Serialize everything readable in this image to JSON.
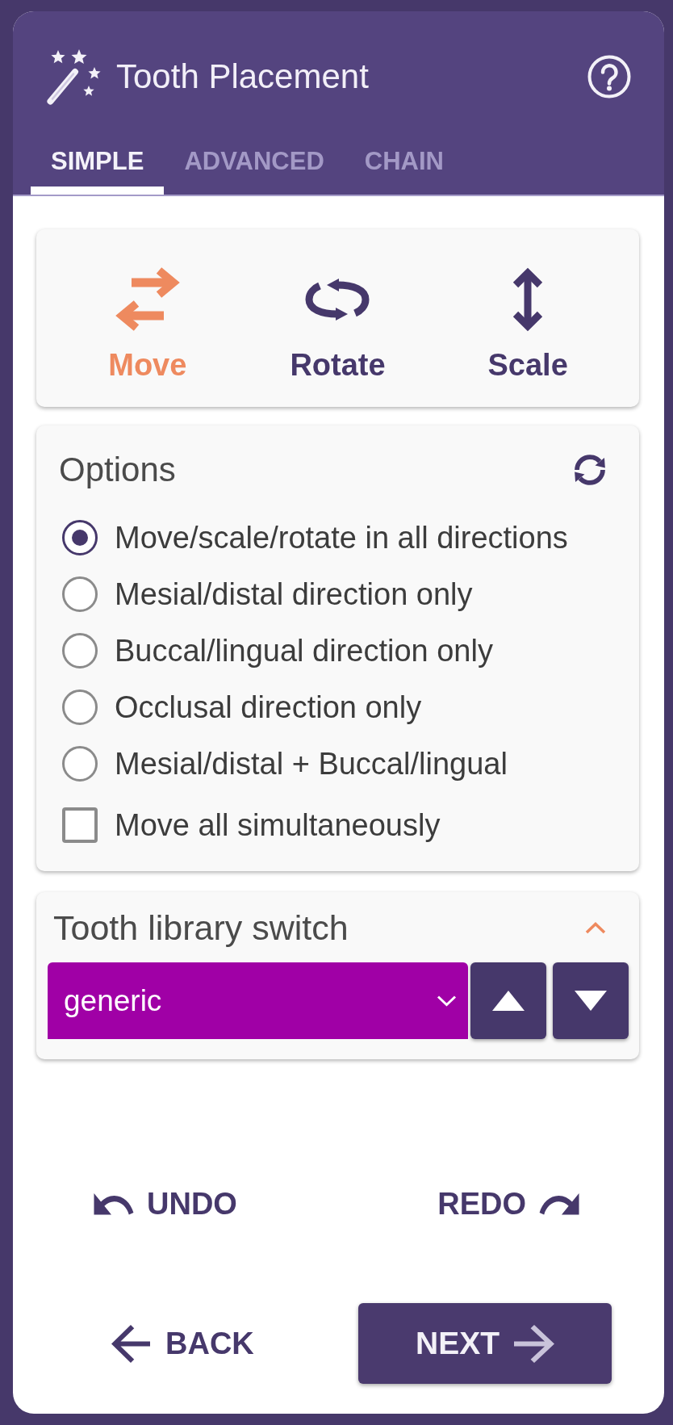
{
  "header": {
    "title": "Tooth Placement"
  },
  "tabs": [
    {
      "label": "SIMPLE",
      "selected": true
    },
    {
      "label": "ADVANCED",
      "selected": false
    },
    {
      "label": "CHAIN",
      "selected": false
    }
  ],
  "tools": [
    {
      "kind": "move",
      "label": "Move",
      "selected": true
    },
    {
      "kind": "rotate",
      "label": "Rotate",
      "selected": false
    },
    {
      "kind": "scale",
      "label": "Scale",
      "selected": false
    }
  ],
  "options": {
    "title": "Options",
    "modes": [
      {
        "label": "Move/scale/rotate in all directions",
        "selected": true
      },
      {
        "label": "Mesial/distal direction only",
        "selected": false
      },
      {
        "label": "Buccal/lingual direction only",
        "selected": false
      },
      {
        "label": "Occlusal direction only",
        "selected": false
      },
      {
        "label": "Mesial/distal + Buccal/lingual",
        "selected": false
      }
    ],
    "checkboxes": [
      {
        "label": "Move all simultaneously",
        "checked": false
      }
    ]
  },
  "library_switch": {
    "title": "Tooth library switch",
    "expanded": true,
    "value": "generic"
  },
  "history": [
    {
      "kind": "undo",
      "label": "UNDO"
    },
    {
      "kind": "redo",
      "label": "REDO"
    }
  ],
  "navigation": [
    {
      "kind": "back",
      "label": "BACK"
    },
    {
      "kind": "next",
      "label": "NEXT"
    }
  ]
}
